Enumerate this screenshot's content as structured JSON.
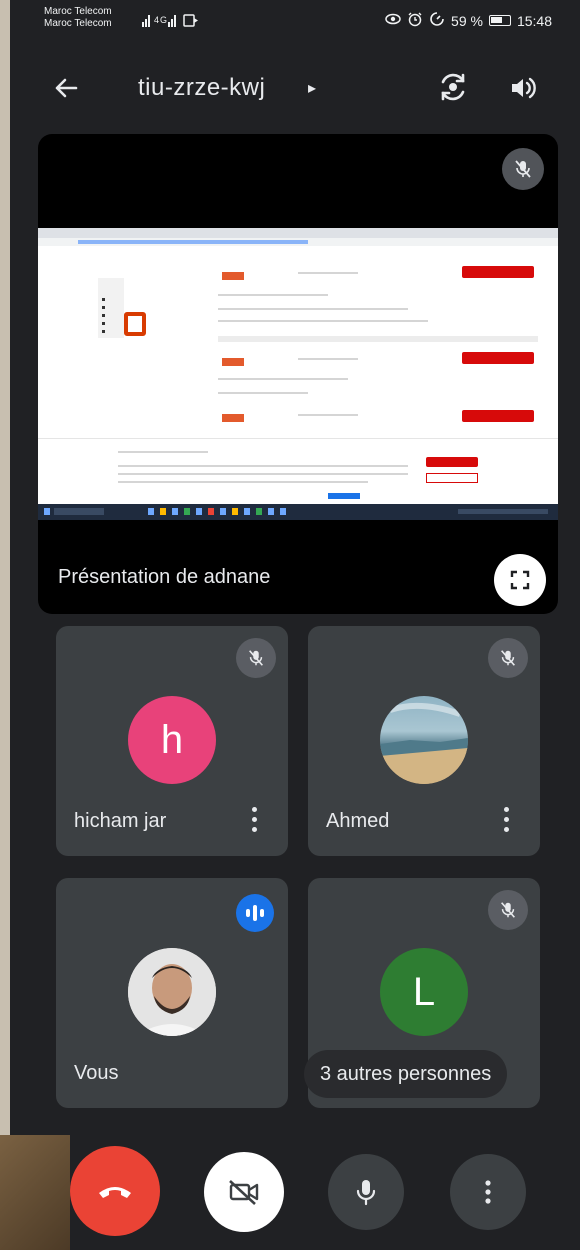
{
  "status_bar": {
    "carrier_1": "Maroc Telecom",
    "carrier_2": "Maroc Telecom",
    "signal": "4G",
    "battery": "59 %",
    "time": "15:48"
  },
  "top_bar": {
    "meeting_code": "tiu-zrze-kwj",
    "caret": "▸"
  },
  "presentation": {
    "label": "Présentation de adnane"
  },
  "participants": [
    {
      "name": "hicham jar",
      "initial": "h",
      "avatar_color": "#e8427a",
      "mic": "off"
    },
    {
      "name": "Ahmed",
      "mic": "off"
    },
    {
      "name": "Vous",
      "mic": "speaking"
    },
    {
      "initial": "L",
      "avatar_color": "#2e7d32",
      "others_label": "3 autres personnes",
      "mic": "off"
    }
  ],
  "controls": {
    "end_call_color": "#ea4335",
    "camera": "off",
    "mic": "on"
  },
  "colors": {
    "background": "#202124",
    "tile": "#3c4043",
    "accent": "#1a73e8"
  }
}
